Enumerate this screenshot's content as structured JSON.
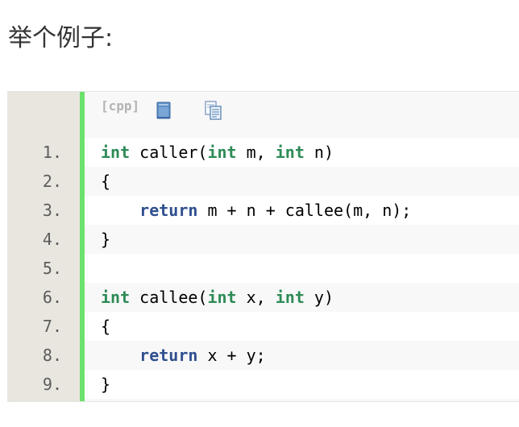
{
  "heading": "举个例子:",
  "code_block": {
    "language_label": "[cpp]",
    "toolbar_icons": [
      "view-plain-icon",
      "copy-code-icon"
    ],
    "colors": {
      "gutter_bg": "#e8e6df",
      "gutter_border": "#6ce26c",
      "keyword_type": "#2e8b57",
      "keyword_return": "#2f4f8f",
      "line_number": "#5c5c5c"
    },
    "lines": [
      {
        "num": "1.",
        "indent": "",
        "tokens": [
          {
            "t": "int",
            "c": "kw-type"
          },
          {
            "t": " caller("
          },
          {
            "t": "int",
            "c": "kw-type"
          },
          {
            "t": " m, "
          },
          {
            "t": "int",
            "c": "kw-type"
          },
          {
            "t": " n)"
          }
        ]
      },
      {
        "num": "2.",
        "indent": "",
        "tokens": [
          {
            "t": "{"
          }
        ]
      },
      {
        "num": "3.",
        "indent": "    ",
        "tokens": [
          {
            "t": "return",
            "c": "kw-ret"
          },
          {
            "t": " m + n + callee(m, n);"
          }
        ]
      },
      {
        "num": "4.",
        "indent": "",
        "tokens": [
          {
            "t": "}"
          }
        ]
      },
      {
        "num": "5.",
        "indent": "",
        "tokens": []
      },
      {
        "num": "6.",
        "indent": "",
        "tokens": [
          {
            "t": "int",
            "c": "kw-type"
          },
          {
            "t": " callee("
          },
          {
            "t": "int",
            "c": "kw-type"
          },
          {
            "t": " x, "
          },
          {
            "t": "int",
            "c": "kw-type"
          },
          {
            "t": " y)"
          }
        ]
      },
      {
        "num": "7.",
        "indent": "",
        "tokens": [
          {
            "t": "{"
          }
        ]
      },
      {
        "num": "8.",
        "indent": "    ",
        "tokens": [
          {
            "t": "return",
            "c": "kw-ret"
          },
          {
            "t": " x + y;"
          }
        ]
      },
      {
        "num": "9.",
        "indent": "",
        "tokens": [
          {
            "t": "}"
          }
        ]
      }
    ]
  }
}
